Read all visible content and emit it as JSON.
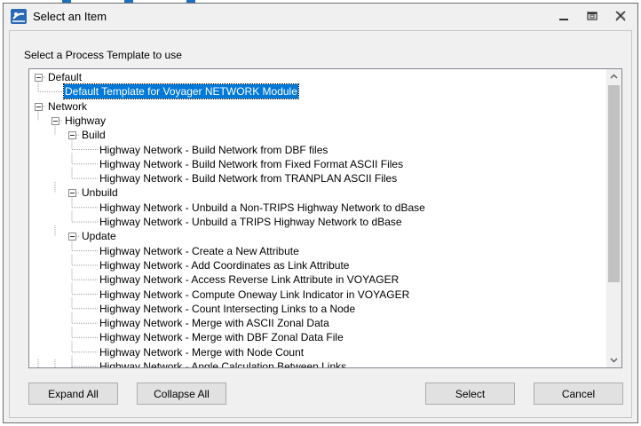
{
  "dialog": {
    "title": "Select an Item",
    "prompt": "Select a Process Template to use"
  },
  "tree": [
    {
      "label": "Default",
      "level": 0,
      "expander": true
    },
    {
      "label": "Default Template for Voyager NETWORK Module",
      "level": 1,
      "selected": true
    },
    {
      "label": "Network",
      "level": 0,
      "expander": true
    },
    {
      "label": "Highway",
      "level": 1,
      "expander": true
    },
    {
      "label": "Build",
      "level": 2,
      "expander": true
    },
    {
      "label": "Highway Network - Build Network from DBF files",
      "level": 3
    },
    {
      "label": "Highway Network - Build Network from Fixed Format ASCII Files",
      "level": 3
    },
    {
      "label": "Highway Network - Build Network from TRANPLAN ASCII Files",
      "level": 3
    },
    {
      "label": "Unbuild",
      "level": 2,
      "expander": true
    },
    {
      "label": "Highway Network - Unbuild a Non-TRIPS Highway Network to dBase",
      "level": 3
    },
    {
      "label": "Highway Network - Unbuild a TRIPS Highway Network to dBase",
      "level": 3
    },
    {
      "label": "Update",
      "level": 2,
      "expander": true
    },
    {
      "label": "Highway Network - Create a New Attribute",
      "level": 3
    },
    {
      "label": "Highway Network - Add Coordinates as Link Attribute",
      "level": 3
    },
    {
      "label": "Highway Network - Access Reverse Link Attribute in VOYAGER",
      "level": 3
    },
    {
      "label": "Highway Network - Compute Oneway Link Indicator in VOYAGER",
      "level": 3
    },
    {
      "label": "Highway Network - Count Intersecting Links to a Node",
      "level": 3
    },
    {
      "label": "Highway Network - Merge with ASCII Zonal Data",
      "level": 3
    },
    {
      "label": "Highway Network - Merge with DBF Zonal Data File",
      "level": 3
    },
    {
      "label": "Highway Network - Merge with Node Count",
      "level": 3
    },
    {
      "label": "Highway Network - Angle Calculation Between Links",
      "level": 3
    }
  ],
  "buttons": {
    "expand_all": "Expand All",
    "collapse_all": "Collapse All",
    "select": "Select",
    "cancel": "Cancel"
  },
  "icons": {
    "app": "app-icon",
    "minimize": "minimize-icon",
    "restore": "restore-icon",
    "close": "close-icon",
    "scroll_up": "chevron-up-icon",
    "scroll_down": "chevron-down-icon",
    "tree_expander": "minus-box-icon"
  },
  "colors": {
    "selection": "#0078d7",
    "app_icon": "#2a69b5",
    "dialog_background": "#f0f0f0"
  }
}
